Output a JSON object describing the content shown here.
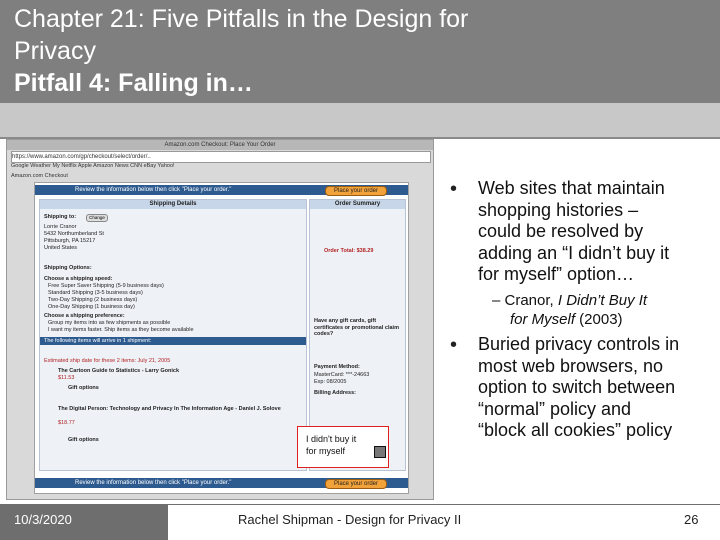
{
  "title": {
    "line1": "Chapter 21: Five Pitfalls in the Design for",
    "line2": "Privacy",
    "line3": "Pitfall 4: Falling in…"
  },
  "screenshot": {
    "window_title": "Amazon.com Checkout: Place Your Order",
    "url": "https://www.amazon.com/gp/checkout/select/order/..",
    "bookmarks": "Google  Weather  My Netflix  Apple  Amazon  News  CNN  eBay  Yahoo!",
    "tab": "Amazon.com Checkout",
    "review_banner": "Review the information below then click \"Place your order.\"",
    "place_order": "Place your order",
    "shipping_details": "Shipping Details",
    "order_summary": "Order Summary",
    "shipping_to": "Shipping to:",
    "change": "Change",
    "address": [
      "Lorrie Cranor",
      "5432 Northumberland St",
      "Pittsburgh, PA 15217",
      "United States"
    ],
    "shipping_options": "Shipping Options:",
    "choose_speed": "Choose a shipping speed:",
    "speeds": [
      "Free Super Saver Shipping (5-9 business days)",
      "Standard Shipping (3-5 business days)",
      "Two-Day Shipping (2 business days)",
      "One-Day Shipping (1 business day)"
    ],
    "choose_pref": "Choose a shipping preference:",
    "prefs": [
      "Group my items into as few shipments as possible",
      "I want my items faster. Ship items as they become available"
    ],
    "shipment_header": "The following items will arrive in 1 shipment:",
    "estimated": "Estimated ship date for these 2 items: July 21, 2005",
    "item1": "The Cartoon Guide to Statistics - Larry Gonick",
    "item1_price": "$11.53",
    "item2": "The Digital Person: Technology and Privacy In The Information Age - Daniel J. Solove",
    "item2_price": "$18.77",
    "gift_options": "Gift options",
    "order_total": "Order Total: $38.29",
    "payment": "Payment Method:",
    "card": "MasterCard: ***-24663",
    "exp": "Exp: 08/2005",
    "billing": "Billing Address:",
    "gift_cards": "Have any gift cards, gift certificates or promotional claim codes?",
    "callout": [
      "I didn't buy it",
      "for myself"
    ]
  },
  "bullets": [
    {
      "lines": [
        "Web sites that maintain",
        "shopping histories –",
        "could be resolved by",
        "adding an “I didn’t buy it",
        "for myself” option…"
      ]
    },
    {
      "lines": [
        "Buried privacy controls in",
        "most web browsers, no",
        "option to switch between",
        "“normal” policy and",
        "“block all cookies” policy"
      ]
    }
  ],
  "sub_bullet": {
    "prefix": "– Cranor, ",
    "italic1": "I Didn’t Buy It",
    "italic2": "for Myself",
    "suffix": " (2003)"
  },
  "footer": {
    "date": "10/3/2020",
    "title": "Rachel Shipman - Design for Privacy II",
    "page": "26"
  },
  "colors": {
    "title_bg": "#7f7f7f",
    "footer_date_bg": "#6e6e6e",
    "amazon_blue": "#2e5b8f",
    "amazon_orange": "#f2a23a"
  }
}
